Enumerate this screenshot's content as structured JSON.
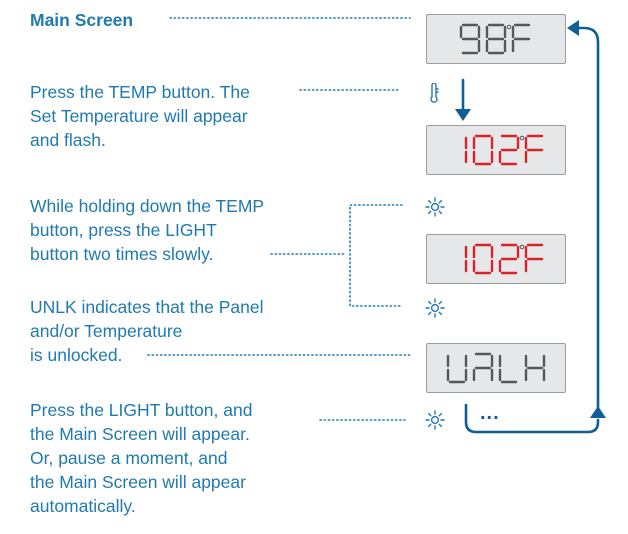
{
  "colors": {
    "text": "#1f7ab0",
    "accent": "#0d5f96",
    "lcd_on_red": "#d8232a",
    "lcd_on_gray": "#555759",
    "lcd_bg": "#e6e7e8"
  },
  "steps": [
    {
      "text": "Main Screen"
    },
    {
      "text": "Press the TEMP button. The\nSet Temperature will appear\nand flash."
    },
    {
      "text": "While holding down the TEMP\nbutton, press the LIGHT\nbutton two times slowly."
    },
    {
      "text": "UNLK indicates that the Panel\nand/or Temperature\nis unlocked."
    },
    {
      "text": "Press the LIGHT button, and\nthe Main Screen will appear.\nOr, pause a moment, and\nthe Main Screen will appear\nautomatically."
    }
  ],
  "displays": [
    {
      "value": "98F",
      "color": "gray"
    },
    {
      "value": "102F",
      "color": "red"
    },
    {
      "value": "102F",
      "color": "red"
    },
    {
      "value": "UNLK",
      "color": "gray"
    }
  ],
  "icons": [
    "thermometer-icon",
    "light-icon",
    "light-icon",
    "light-icon"
  ],
  "ellipsis": "..."
}
